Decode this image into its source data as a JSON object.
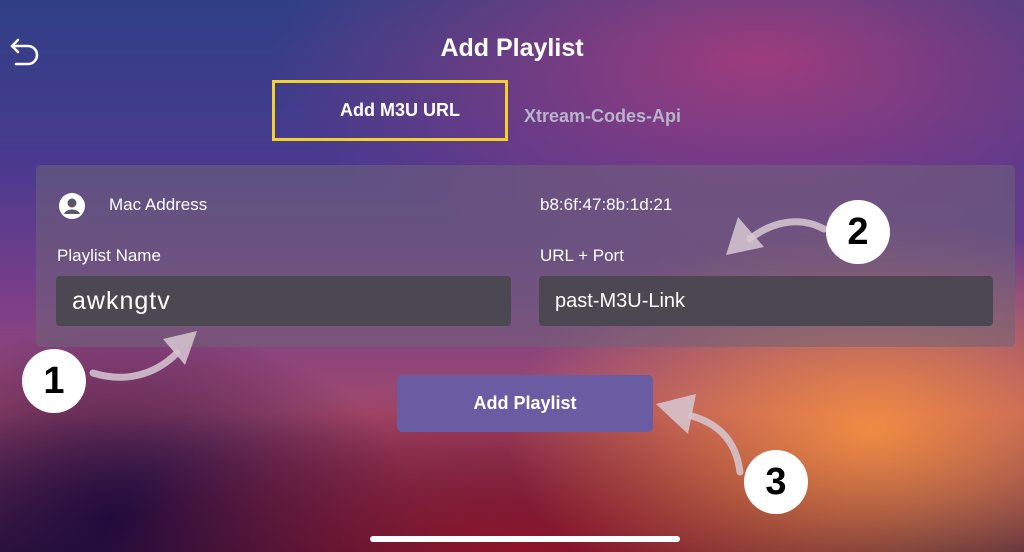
{
  "header": {
    "title": "Add Playlist",
    "back_icon": "back-arrow-icon"
  },
  "tabs": [
    {
      "label": "Add M3U URL",
      "active": true
    },
    {
      "label": "Xtream-Codes-Api",
      "active": false
    }
  ],
  "form": {
    "mac_label": "Mac Address",
    "mac_value": "b8:6f:47:8b:1d:21",
    "playlist_name_label": "Playlist Name",
    "playlist_name_value": "awkngtv",
    "url_label": "URL + Port",
    "url_value": "past-M3U-Link",
    "submit_label": "Add Playlist"
  },
  "annotations": {
    "step1": "1",
    "step2": "2",
    "step3": "3"
  },
  "colors": {
    "highlight": "#f1d22a",
    "button": "#6a5ca3",
    "input_bg": "#4c4852"
  }
}
